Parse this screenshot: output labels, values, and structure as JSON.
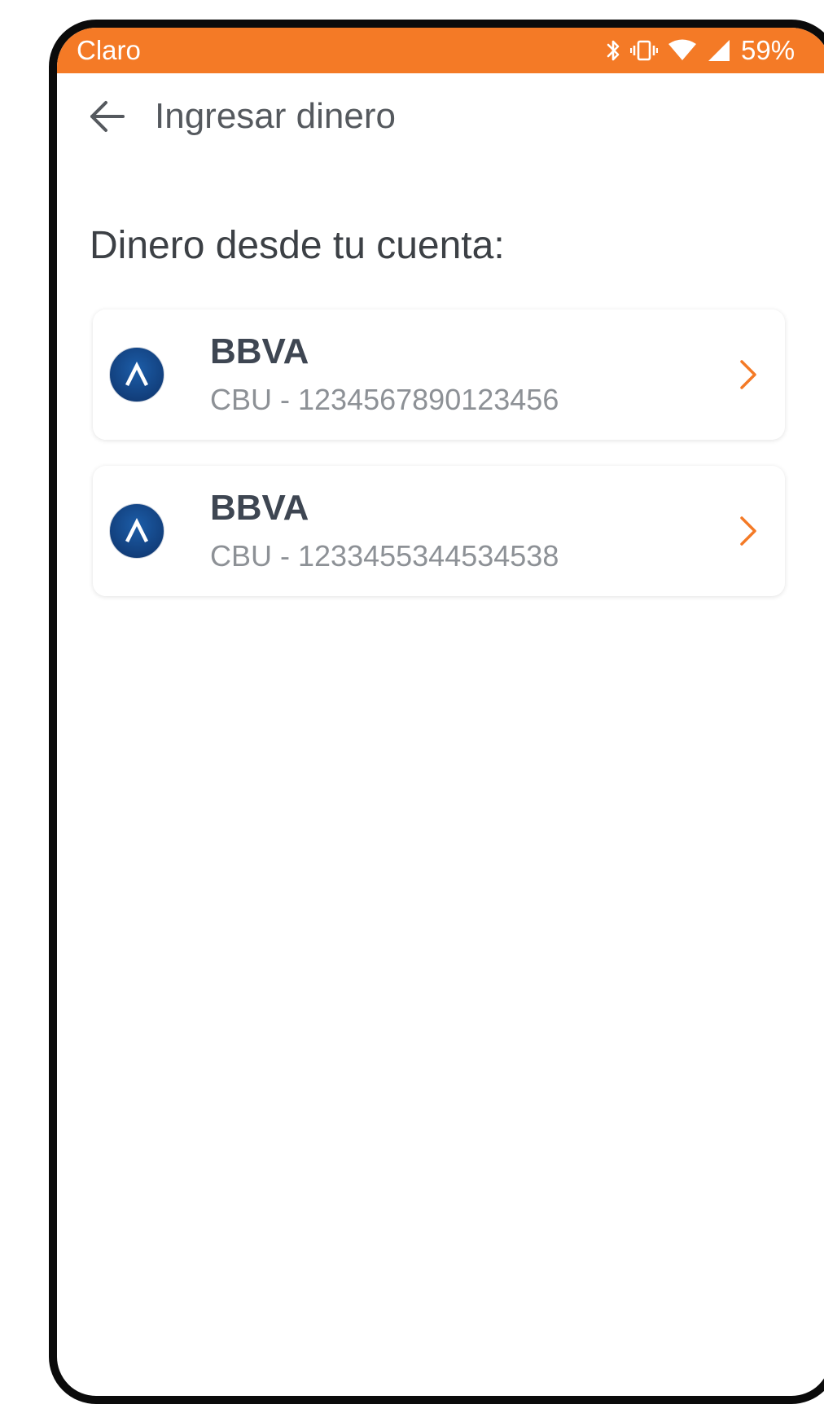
{
  "status_bar": {
    "carrier": "Claro",
    "battery": "59%",
    "icons": [
      "bluetooth-icon",
      "vibrate-icon",
      "wifi-icon",
      "cell-signal-icon"
    ],
    "background_color": "#f47a26"
  },
  "header": {
    "back_icon": "arrow-left-icon",
    "title": "Ingresar dinero"
  },
  "main": {
    "section_title": "Dinero desde tu cuenta:",
    "accounts": [
      {
        "bank": "BBVA",
        "cbu": "CBU - 1234567890123456",
        "logo": "bbva-logo",
        "action_icon": "chevron-right-icon"
      },
      {
        "bank": "BBVA",
        "cbu": "CBU - 1233455344534538",
        "logo": "bbva-logo",
        "action_icon": "chevron-right-icon"
      }
    ]
  },
  "colors": {
    "accent": "#f47a26",
    "text_primary": "#3e4652",
    "text_secondary": "#8d9196",
    "logo_blue": "#123f7c"
  }
}
